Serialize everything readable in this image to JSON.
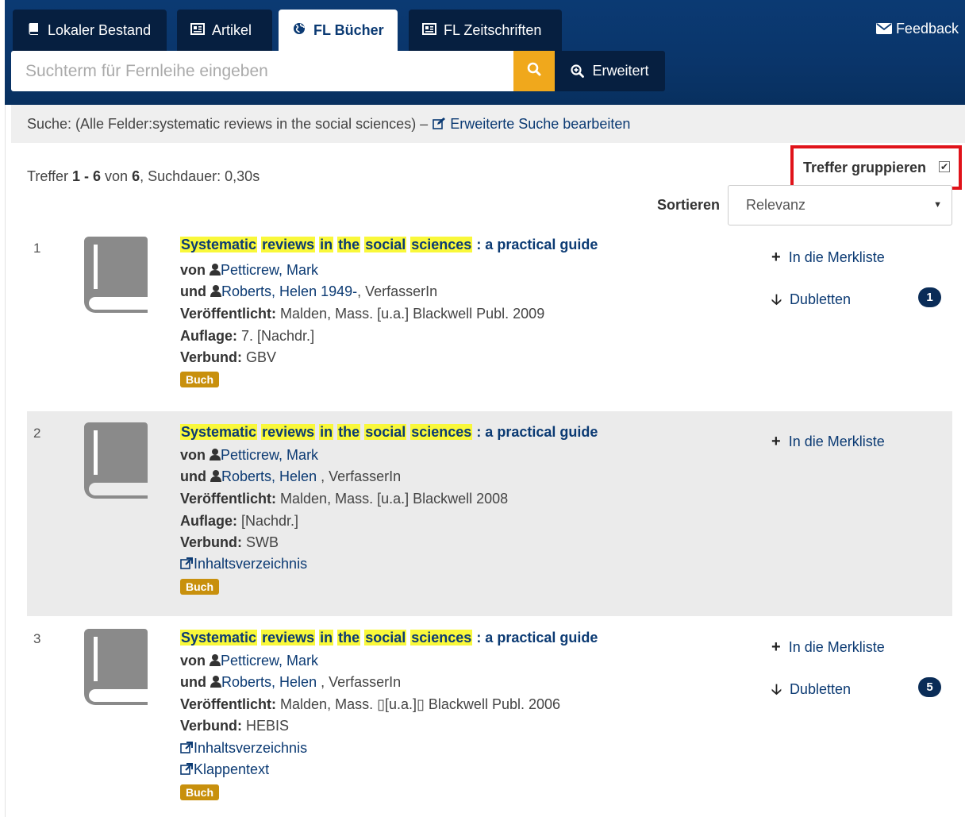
{
  "tabs": [
    {
      "label": "Lokaler Bestand",
      "icon": "book-icon"
    },
    {
      "label": "Artikel",
      "icon": "newspaper-icon"
    },
    {
      "label": "FL Bücher",
      "icon": "globe-icon",
      "active": true
    },
    {
      "label": "FL Zeitschriften",
      "icon": "newspaper-icon"
    }
  ],
  "feedback_label": "Feedback",
  "search": {
    "placeholder": "Suchterm für Fernleihe eingeben",
    "advanced_label": "Erweitert"
  },
  "search_summary": {
    "text": "Suche: (Alle Felder:systematic reviews in the social sciences) –",
    "edit_label": "Erweiterte Suche bearbeiten"
  },
  "hits": {
    "prefix": "Treffer ",
    "range": "1 - 6",
    "of": " von ",
    "total": "6",
    "duration": ", Suchdauer: 0,30s"
  },
  "group_hits": {
    "label": "Treffer gruppieren",
    "checked": true
  },
  "sort": {
    "label": "Sortieren",
    "selected": "Relevanz"
  },
  "results": [
    {
      "number": "1",
      "title_words": [
        "Systematic",
        "reviews",
        "in",
        "the",
        "social",
        "sciences"
      ],
      "title_rest": ": a practical guide",
      "von": "von",
      "author1": "Petticrew, Mark",
      "und": "und",
      "author2": "Roberts, Helen 1949-",
      "author2_role": ", VerfasserIn",
      "published_label": "Veröffentlicht:",
      "published": "Malden, Mass. [u.a.] Blackwell Publ. 2009",
      "edition_label": "Auflage:",
      "edition": "7. [Nachdr.]",
      "verbund_label": "Verbund:",
      "verbund": "GBV",
      "badge": "Buch",
      "merkliste": "In die Merkliste",
      "dubletten": "Dubletten",
      "dubletten_count": "1"
    },
    {
      "number": "2",
      "title_words": [
        "Systematic",
        "reviews",
        "in",
        "the",
        "social",
        "sciences"
      ],
      "title_rest": ": a practical guide",
      "von": "von",
      "author1": "Petticrew, Mark",
      "und": "und",
      "author2": "Roberts, Helen",
      "author2_role": ", VerfasserIn",
      "published_label": "Veröffentlicht:",
      "published": "Malden, Mass. [u.a.] Blackwell 2008",
      "edition_label": "Auflage:",
      "edition": "[Nachdr.]",
      "verbund_label": "Verbund:",
      "verbund": "SWB",
      "link1": "Inhaltsverzeichnis",
      "badge": "Buch",
      "merkliste": "In die Merkliste"
    },
    {
      "number": "3",
      "title_words": [
        "Systematic",
        "reviews",
        "in",
        "the",
        "social",
        "sciences"
      ],
      "title_rest": ": a practical guide",
      "von": "von",
      "author1": "Petticrew, Mark",
      "und": "und",
      "author2": "Roberts, Helen",
      "author2_role": ", VerfasserIn",
      "published_label": "Veröffentlicht:",
      "published": "Malden, Mass. ▯[u.a.]▯ Blackwell Publ. 2006",
      "verbund_label": "Verbund:",
      "verbund": "HEBIS",
      "link1": "Inhaltsverzeichnis",
      "link2": "Klappentext",
      "badge": "Buch",
      "merkliste": "In die Merkliste",
      "dubletten": "Dubletten",
      "dubletten_count": "5"
    }
  ]
}
